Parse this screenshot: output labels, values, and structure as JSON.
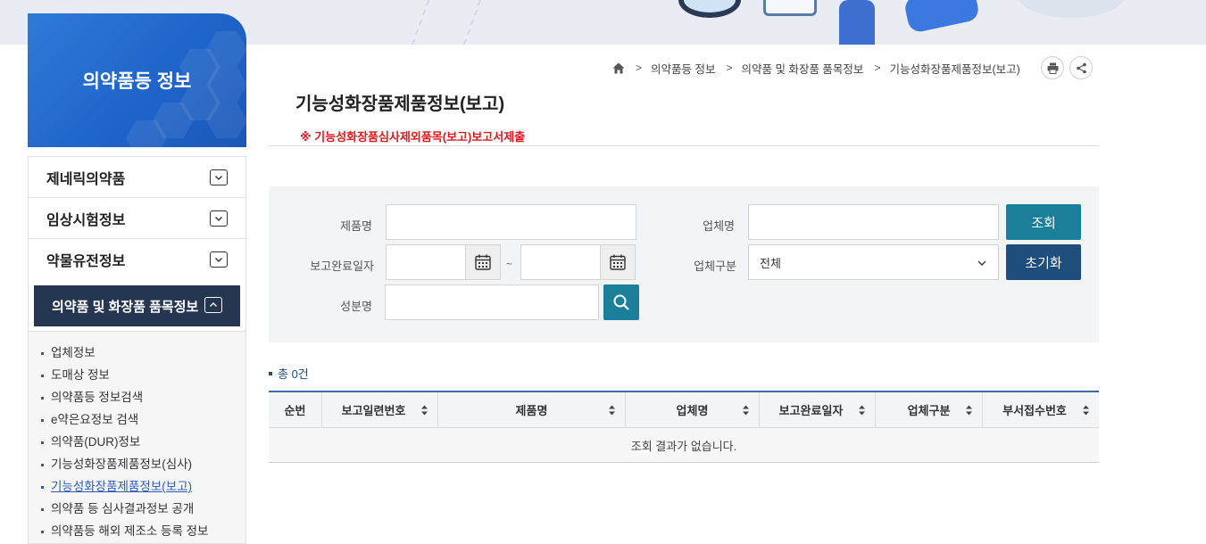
{
  "sidebar": {
    "title": "의약품등 정보",
    "menu": [
      {
        "label": "제네릭의약품"
      },
      {
        "label": "임상시험정보"
      },
      {
        "label": "약물유전정보"
      }
    ],
    "active": {
      "label": "의약품 및 화장품 품목정보"
    },
    "submenu": [
      "업체정보",
      "도매상 정보",
      "의약품등 정보검색",
      "e약은요정보 검색",
      "의약품(DUR)정보",
      "기능성화장품제품정보(심사)",
      "기능성화장품제품정보(보고)",
      "의약품 등 심사결과정보 공개",
      "의약품등 해외 제조소 등록 정보"
    ],
    "current_submenu": "기능성화장품제품정보(보고)"
  },
  "breadcrumb": {
    "items": [
      "의약품등 정보",
      "의약품 및 화장품 품목정보",
      "기능성화장품제품정보(보고)"
    ]
  },
  "page": {
    "title": "기능성화장품제품정보(보고)",
    "notice": "※ 기능성화장품심사제외품목(보고)보고서제출"
  },
  "search": {
    "product_label": "제품명",
    "product_value": "",
    "company_label": "업체명",
    "company_value": "",
    "date_label": "보고완료일자",
    "date_from": "",
    "date_to": "",
    "date_sep": "~",
    "type_label": "업체구분",
    "type_selected": "전체",
    "ingredient_label": "성분명",
    "ingredient_value": "",
    "search_button": "조회",
    "reset_button": "초기화"
  },
  "result": {
    "total_text": "총 0건",
    "columns": [
      "순번",
      "보고일련번호",
      "제품명",
      "업체명",
      "보고완료일자",
      "업체구분",
      "부서접수번호"
    ],
    "empty_message": "조회 결과가 없습니다."
  },
  "colors": {
    "sidebar_header": "#1e63c8",
    "active_menu": "#253650",
    "teal_button": "#1b7f9a",
    "navy_button": "#1d4e7c",
    "notice_red": "#e0161e"
  }
}
